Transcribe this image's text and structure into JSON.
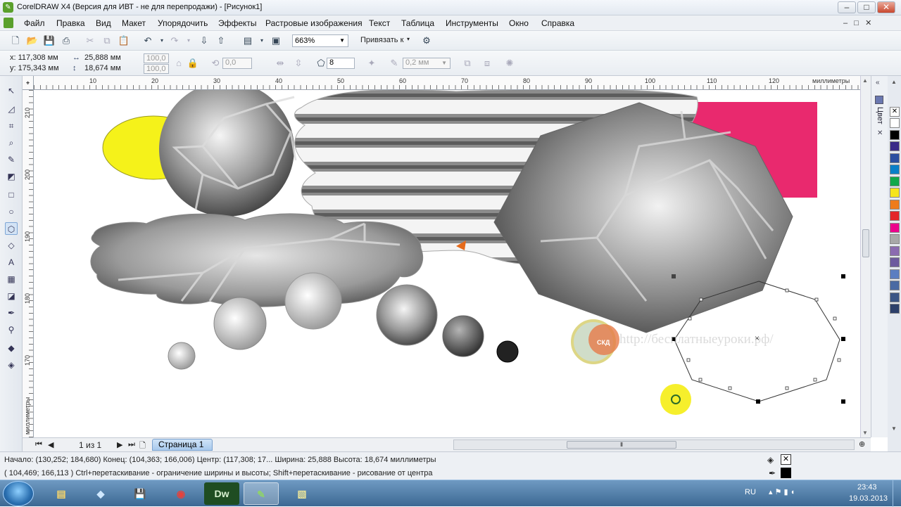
{
  "window": {
    "title": "CorelDRAW X4 (Версия для ИВТ - не для перепродажи) - [Рисунок1]"
  },
  "menu": [
    "Файл",
    "Правка",
    "Вид",
    "Макет",
    "Упорядочить",
    "Эффекты",
    "Растровые изображения",
    "Текст",
    "Таблица",
    "Инструменты",
    "Окно",
    "Справка"
  ],
  "toolbar": {
    "zoom": "663%",
    "snap_label": "Привязать к"
  },
  "property_bar": {
    "x": "x: 117,308 мм",
    "y": "y: 175,343 мм",
    "width": "25,888 мм",
    "height": "18,674 мм",
    "scale_x": "100,0",
    "scale_y": "100,0",
    "angle": "0,0",
    "sides": "8",
    "outline": "0,2 мм"
  },
  "ruler": {
    "units": "миллиметры",
    "h_ticks": [
      "10",
      "20",
      "30",
      "40",
      "50",
      "60",
      "70",
      "80",
      "90",
      "100",
      "110",
      "120"
    ],
    "v_ticks": [
      "210",
      "200",
      "190",
      "180",
      "170"
    ]
  },
  "canvas": {
    "watermark": "http://бесплатныеуроки.рф/",
    "logo_text": "СКД"
  },
  "docker": {
    "tab_label": "Цвет"
  },
  "palette": [
    "#ffffff",
    "#000000",
    "#3a2a88",
    "#2c4fa0",
    "#0a7fc8",
    "#11a84a",
    "#f6e51b",
    "#ee7b1b",
    "#e3262a",
    "#ec008c",
    "#a8a8a8",
    "#8b6bb0",
    "#6d5a9e",
    "#5b7ec1",
    "#4a6aa3",
    "#3b5585",
    "#2d406a"
  ],
  "page_nav": {
    "counter": "1 из 1",
    "tab": "Страница 1"
  },
  "status": {
    "line1": "Начало: (130,252; 184,680)  Конец: (104,363; 166,006)  Центр: (117,308; 17...  Ширина: 25,888  Высота: 18,674  миллиметры",
    "line2": "( 104,469; 166,113 )      Ctrl+перетаскивание - ограничение ширины и высоты; Shift+перетаскивание - рисование от центра"
  },
  "taskbar": {
    "lang": "RU",
    "time": "23:43",
    "date": "19.03.2013",
    "apps": [
      "Explorer",
      "Notepad",
      "Save",
      "Chrome",
      "DW",
      "CorelDRAW",
      "Notes"
    ]
  },
  "colors": {
    "yellow": "#f5f21a",
    "pink": "#e9296e",
    "orange": "#e66a1a"
  }
}
